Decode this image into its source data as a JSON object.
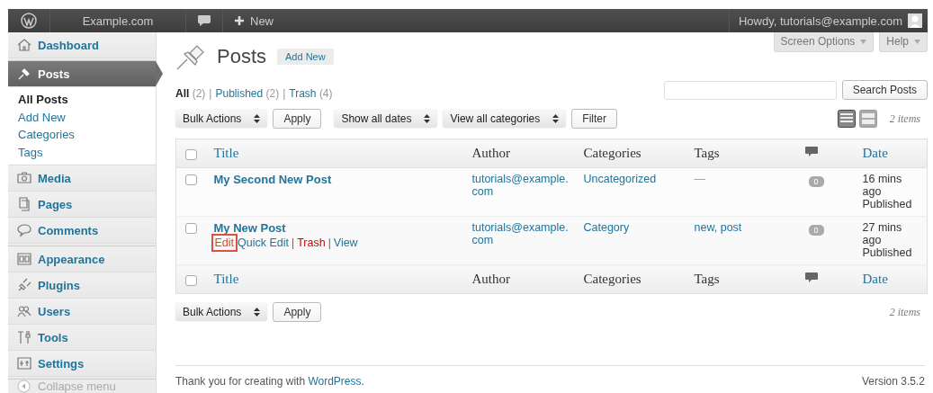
{
  "admin_bar": {
    "site_name": "Example.com",
    "new_label": "New",
    "greeting": "Howdy, tutorials@example.com"
  },
  "sidebar": {
    "groups": [
      [
        {
          "label": "Dashboard",
          "selected": false
        }
      ],
      [
        {
          "label": "Posts",
          "selected": true,
          "expanded": true,
          "children": [
            {
              "label": "All Posts",
              "selected": true
            },
            {
              "label": "Add New",
              "selected": false
            },
            {
              "label": "Categories",
              "selected": false
            },
            {
              "label": "Tags",
              "selected": false
            }
          ]
        },
        {
          "label": "Media",
          "selected": false
        },
        {
          "label": "Pages",
          "selected": false
        },
        {
          "label": "Comments",
          "selected": false
        }
      ],
      [
        {
          "label": "Appearance",
          "selected": false
        },
        {
          "label": "Plugins",
          "selected": false
        },
        {
          "label": "Users",
          "selected": false
        },
        {
          "label": "Tools",
          "selected": false
        },
        {
          "label": "Settings",
          "selected": false
        }
      ]
    ],
    "collapse_label": "Collapse menu"
  },
  "header": {
    "title": "Posts",
    "add_new": "Add New",
    "screen_options": "Screen Options",
    "help": "Help"
  },
  "status_links": [
    {
      "label": "All",
      "count": "(2)",
      "selected": true
    },
    {
      "label": "Published",
      "count": "(2)",
      "selected": false,
      "sep": "|"
    },
    {
      "label": "Trash",
      "count": "(4)",
      "selected": false,
      "sep": "|"
    }
  ],
  "search": {
    "button": "Search Posts"
  },
  "tablenav_top": {
    "bulk_actions": "Bulk Actions",
    "apply": "Apply",
    "dates": "Show all dates",
    "categories": "View all categories",
    "filter": "Filter",
    "view_modes": [
      {
        "kind": "list",
        "selected": true
      },
      {
        "kind": "excerpt",
        "selected": false
      }
    ],
    "count": "2 items"
  },
  "table": {
    "columns": [
      {
        "kind": "checkbox",
        "checked": false
      },
      {
        "kind": "text",
        "label": "Title",
        "sortable": true
      },
      {
        "kind": "text",
        "label": "Author",
        "sortable": false
      },
      {
        "kind": "text",
        "label": "Categories",
        "sortable": false
      },
      {
        "kind": "text",
        "label": "Tags",
        "sortable": false
      },
      {
        "kind": "comments"
      },
      {
        "kind": "text",
        "label": "Date",
        "sortable": true
      }
    ],
    "rows": [
      {
        "checked": false,
        "title": "My Second New Post",
        "author": "tutorials@example.com",
        "categories": "Uncategorized",
        "tags": {
          "text": "—",
          "kind": "none"
        },
        "comments": "0",
        "date": "16 mins ago",
        "status": "Published"
      },
      {
        "checked": false,
        "title": "My New Post",
        "actions": [
          {
            "label": "Edit",
            "kind": "link",
            "highlighted": true
          },
          {
            "label": "Quick Edit",
            "kind": "link",
            "highlighted": false
          },
          {
            "label": "Trash",
            "kind": "delete",
            "highlighted": false,
            "sep": "|"
          },
          {
            "label": "View",
            "kind": "link",
            "highlighted": false,
            "sep": "|"
          }
        ],
        "author": "tutorials@example.com",
        "categories": "Category",
        "tags": {
          "text": "new, post",
          "kind": "link"
        },
        "comments": "0",
        "date": "27 mins ago",
        "status": "Published"
      }
    ],
    "footer_columns": [
      {
        "kind": "checkbox",
        "checked": false
      },
      {
        "kind": "text",
        "label": "Title",
        "sortable": true
      },
      {
        "kind": "text",
        "label": "Author",
        "sortable": false
      },
      {
        "kind": "text",
        "label": "Categories",
        "sortable": false
      },
      {
        "kind": "text",
        "label": "Tags",
        "sortable": false
      },
      {
        "kind": "comments"
      },
      {
        "kind": "text",
        "label": "Date",
        "sortable": true
      }
    ]
  },
  "tablenav_bottom": {
    "bulk_actions": "Bulk Actions",
    "apply": "Apply",
    "count": "2 items"
  },
  "footer": {
    "thanks_before": "Thank you for creating with ",
    "link": "WordPress",
    "thanks_after": ".",
    "version": "Version 3.5.2"
  }
}
